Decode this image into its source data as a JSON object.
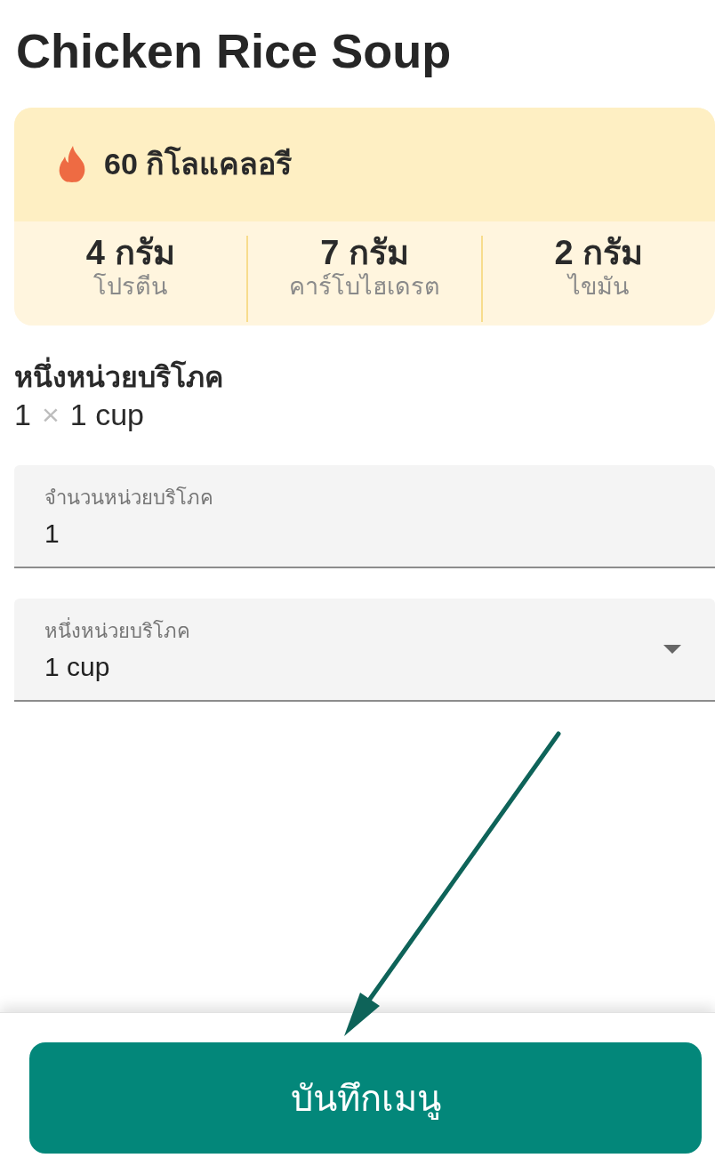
{
  "title": "Chicken Rice Soup",
  "calories": {
    "value": "60 กิโลแคลอรี"
  },
  "macros": [
    {
      "amount": "4 กรัม",
      "label": "โปรตีน"
    },
    {
      "amount": "7 กรัม",
      "label": "คาร์โบไฮเดรต"
    },
    {
      "amount": "2 กรัม",
      "label": "ไขมัน"
    }
  ],
  "serving": {
    "heading": "หนึ่งหน่วยบริโภค",
    "count": "1",
    "times": "×",
    "unit": "1 cup"
  },
  "fields": [
    {
      "kind": "text",
      "label": "จำนวนหน่วยบริโภค",
      "value": "1"
    },
    {
      "kind": "dropdown",
      "label": "หนึ่งหน่วยบริโภค",
      "value": "1 cup"
    }
  ],
  "save_button": {
    "label": "บันทึกเมนู"
  }
}
